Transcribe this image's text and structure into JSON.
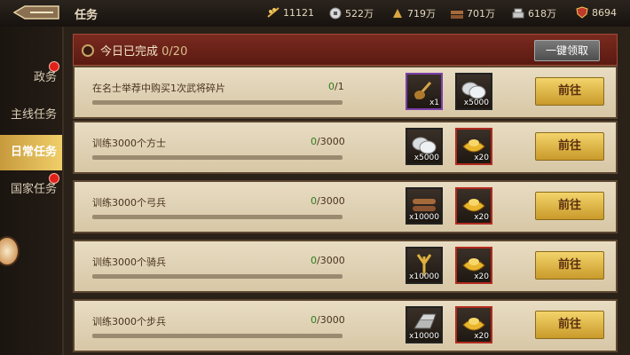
{
  "topbar": {
    "title": "任务",
    "resources": [
      {
        "icon": "wheat-icon",
        "value": "11121"
      },
      {
        "icon": "coin-icon",
        "value": "522万"
      },
      {
        "icon": "grain-icon",
        "value": "719万"
      },
      {
        "icon": "wood-icon",
        "value": "701万"
      },
      {
        "icon": "silver-icon",
        "value": "618万"
      },
      {
        "icon": "shield-icon",
        "value": "8694"
      }
    ]
  },
  "sidebar": {
    "items": [
      {
        "label": "政务",
        "badge": true
      },
      {
        "label": "主线任务",
        "badge": false
      },
      {
        "label": "日常任务",
        "badge": false,
        "active": true
      },
      {
        "label": "国家任务",
        "badge": true
      }
    ]
  },
  "header": {
    "label": "今日已完成",
    "count": "0/20",
    "button": "一键领取"
  },
  "tasks": [
    {
      "name": "在名士举荐中购买1次武将碎片",
      "cur": "0",
      "total": "/1",
      "progress": 0,
      "rewards": [
        {
          "icon": "lute-icon",
          "qty": "x1",
          "frame": "purple"
        },
        {
          "icon": "silver-coins-icon",
          "qty": "x5000",
          "frame": "dark"
        }
      ],
      "button": "前往"
    },
    {
      "name": "训练3000个方士",
      "cur": "0",
      "total": "/3000",
      "progress": 0,
      "rewards": [
        {
          "icon": "silver-coins-icon",
          "qty": "x5000",
          "frame": "dark"
        },
        {
          "icon": "gold-ingot-icon",
          "qty": "x20",
          "frame": "red"
        }
      ],
      "button": "前往"
    },
    {
      "name": "训练3000个弓兵",
      "cur": "0",
      "total": "/3000",
      "progress": 0,
      "rewards": [
        {
          "icon": "wood-logs-icon",
          "qty": "x10000",
          "frame": "dark"
        },
        {
          "icon": "gold-ingot-icon",
          "qty": "x20",
          "frame": "red"
        }
      ],
      "button": "前往"
    },
    {
      "name": "训练3000个骑兵",
      "cur": "0",
      "total": "/3000",
      "progress": 0,
      "rewards": [
        {
          "icon": "wheat-bundle-icon",
          "qty": "x10000",
          "frame": "dark"
        },
        {
          "icon": "gold-ingot-icon",
          "qty": "x20",
          "frame": "red"
        }
      ],
      "button": "前往"
    },
    {
      "name": "训练3000个步兵",
      "cur": "0",
      "total": "/3000",
      "progress": 0,
      "rewards": [
        {
          "icon": "iron-ingot-icon",
          "qty": "x10000",
          "frame": "dark"
        },
        {
          "icon": "gold-ingot-icon",
          "qty": "x20",
          "frame": "red"
        }
      ],
      "button": "前往"
    }
  ]
}
